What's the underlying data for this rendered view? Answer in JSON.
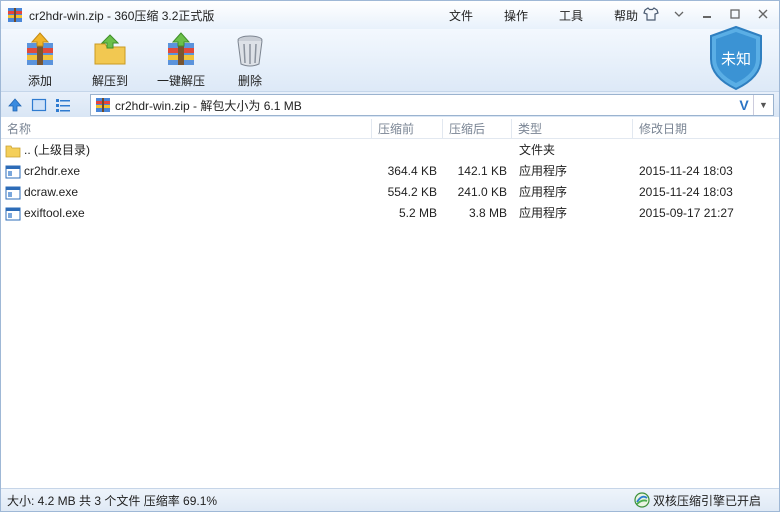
{
  "window": {
    "title": "cr2hdr-win.zip - 360压缩 3.2正式版",
    "menu": [
      "文件",
      "操作",
      "工具",
      "帮助"
    ]
  },
  "toolbar": {
    "add_label": "添加",
    "extract_to_label": "解压到",
    "one_click_label": "一键解压",
    "delete_label": "删除",
    "security_badge": "未知"
  },
  "address": {
    "text": "cr2hdr-win.zip - 解包大小为 6.1 MB",
    "v_label": "V"
  },
  "columns": {
    "name": "名称",
    "size": "压缩前",
    "compressed": "压缩后",
    "type": "类型",
    "modified": "修改日期"
  },
  "rows": [
    {
      "name": ".. (上级目录)",
      "size": "",
      "compressed": "",
      "type": "文件夹",
      "modified": "",
      "icon": "folder-icon"
    },
    {
      "name": "cr2hdr.exe",
      "size": "364.4 KB",
      "compressed": "142.1 KB",
      "type": "应用程序",
      "modified": "2015-11-24 18:03",
      "icon": "exe-icon"
    },
    {
      "name": "dcraw.exe",
      "size": "554.2 KB",
      "compressed": "241.0 KB",
      "type": "应用程序",
      "modified": "2015-11-24 18:03",
      "icon": "exe-icon"
    },
    {
      "name": "exiftool.exe",
      "size": "5.2 MB",
      "compressed": "3.8 MB",
      "type": "应用程序",
      "modified": "2015-09-17 21:27",
      "icon": "exe-icon"
    }
  ],
  "status": {
    "summary": "大小: 4.2 MB 共 3 个文件 压缩率 69.1%",
    "right_text": "双核压缩引擎已开启"
  },
  "colors": {
    "accent": "#2a74c5",
    "shield": "#3e9ad6",
    "titlebar": "#e8f1fb"
  }
}
